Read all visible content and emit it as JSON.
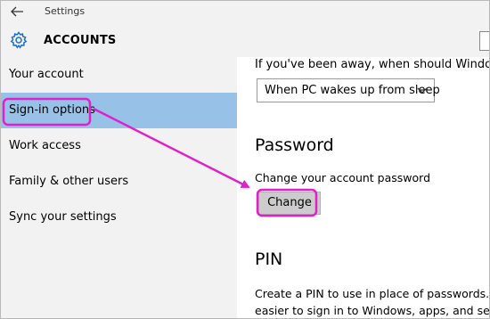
{
  "window": {
    "title": "Settings"
  },
  "header": {
    "title": "ACCOUNTS"
  },
  "sidebar": {
    "items": [
      {
        "label": "Your account",
        "selected": false
      },
      {
        "label": "Sign-in options",
        "selected": true
      },
      {
        "label": "Work access",
        "selected": false
      },
      {
        "label": "Family & other users",
        "selected": false
      },
      {
        "label": "Sync your settings",
        "selected": false
      }
    ]
  },
  "content": {
    "away_text": "If you've been away, when should Windows requ",
    "away_dropdown": {
      "value": "When PC wakes up from sleep"
    },
    "password": {
      "heading": "Password",
      "description": "Change your account password",
      "button_label": "Change"
    },
    "pin": {
      "heading": "PIN",
      "description_line1": "Create a PIN to use in place of passwords. Havin",
      "description_line2": "easier to sign in to Windows, apps, and services."
    }
  },
  "colors": {
    "sidebar_bg": "#f2f2f2",
    "selected_bg": "#98c1e8",
    "accent": "#1a6fc9",
    "annotation": "#e020c8"
  },
  "icons": [
    "back-arrow-icon",
    "gear-icon",
    "chevron-down-icon"
  ]
}
